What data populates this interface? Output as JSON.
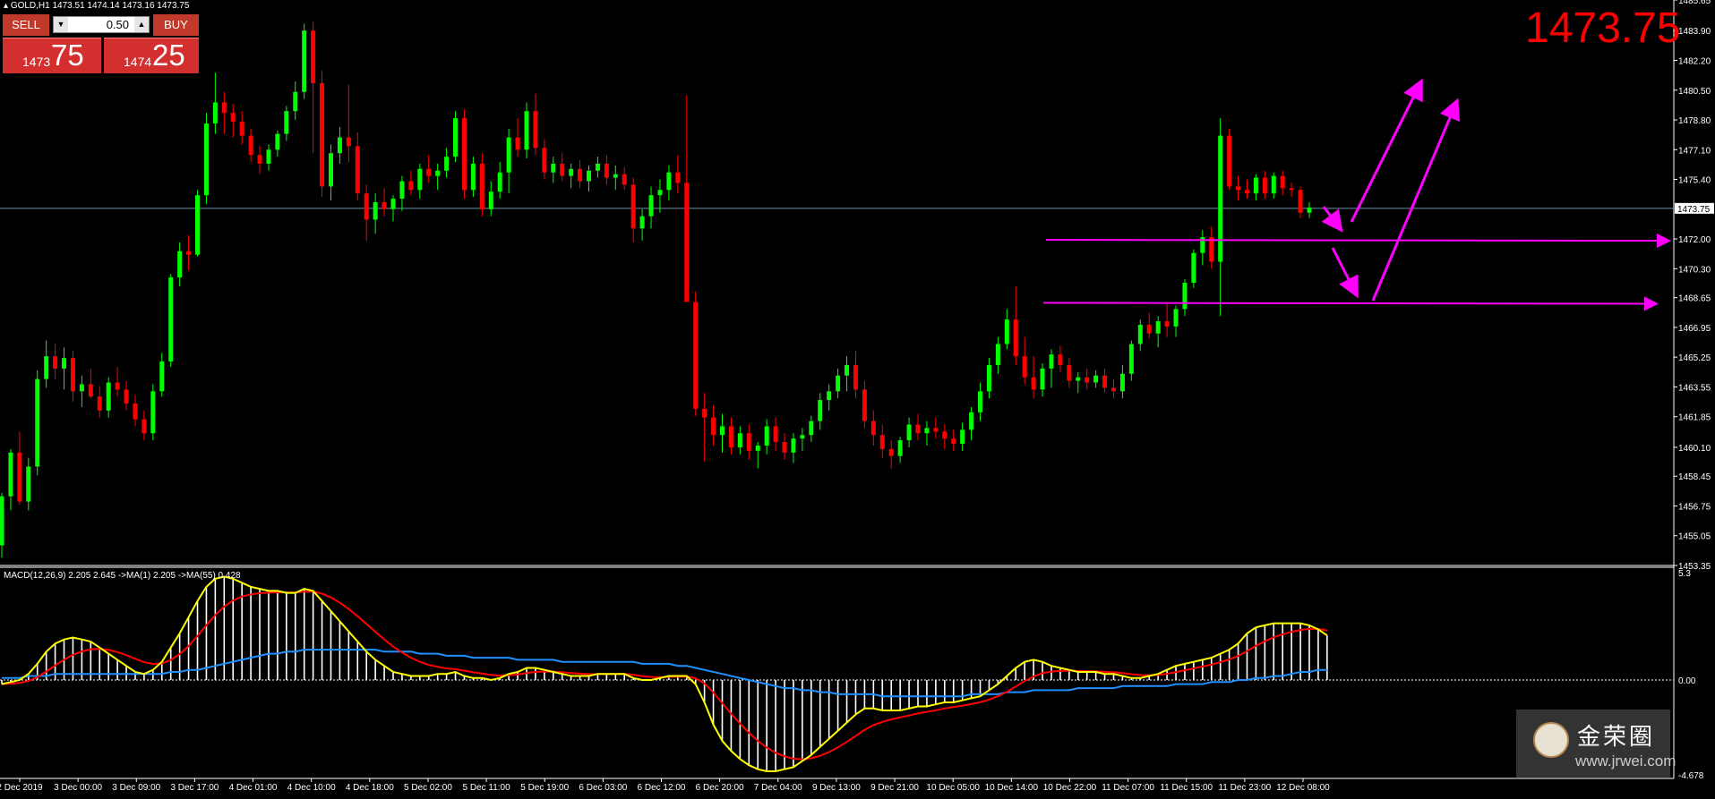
{
  "header": {
    "symbol": "GOLD,H1",
    "ohlc": "1473.51 1474.14 1473.16 1473.75"
  },
  "trade_panel": {
    "sell_label": "SELL",
    "buy_label": "BUY",
    "lot": "0.50",
    "sell_small": "1473",
    "sell_big": "75",
    "buy_small": "1474",
    "buy_big": "25"
  },
  "big_price": "1473.75",
  "macd_label": "MACD(12,26,9) 2.205 2.645 ->MA(1) 2.205 ->MA(55) 0.428",
  "watermark": {
    "title": "金荣圈",
    "url": "www.jrwei.com"
  },
  "colors": {
    "bull": "#00ff00",
    "bear": "#ff0000",
    "arrow": "#ff00ff",
    "grid": "#ffffff",
    "price_line": "#6f8fa8",
    "macd": "#ffff00",
    "signal": "#ff0000",
    "ma55": "#1e90ff",
    "histogram": "#ffffff"
  },
  "chart_data": {
    "type": "candlestick",
    "title": "",
    "ylim": [
      1453.35,
      1485.65
    ],
    "y_ticks": [
      "1485.65",
      "1483.90",
      "1482.20",
      "1480.50",
      "1478.80",
      "1477.10",
      "1475.40",
      "1472.00",
      "1470.30",
      "1468.65",
      "1466.95",
      "1465.25",
      "1463.55",
      "1461.85",
      "1460.10",
      "1458.45",
      "1456.75",
      "1455.05",
      "1453.35"
    ],
    "current_price": "1473.75",
    "x_ticks": [
      "2 Dec 2019",
      "3 Dec 00:00",
      "3 Dec 09:00",
      "3 Dec 17:00",
      "4 Dec 01:00",
      "4 Dec 10:00",
      "4 Dec 18:00",
      "5 Dec 02:00",
      "5 Dec 11:00",
      "5 Dec 19:00",
      "6 Dec 03:00",
      "6 Dec 12:00",
      "6 Dec 20:00",
      "7 Dec 04:00",
      "9 Dec 13:00",
      "9 Dec 21:00",
      "10 Dec 05:00",
      "10 Dec 14:00",
      "10 Dec 22:00",
      "11 Dec 07:00",
      "11 Dec 15:00",
      "11 Dec 23:00",
      "12 Dec 08:00"
    ],
    "candles": [
      [
        1454.5,
        1457.5,
        1453.8,
        1457.3
      ],
      [
        1457.3,
        1460.0,
        1456.5,
        1459.8
      ],
      [
        1459.8,
        1461.0,
        1456.8,
        1457.0
      ],
      [
        1457.0,
        1459.5,
        1456.5,
        1459.0
      ],
      [
        1459.0,
        1464.5,
        1458.5,
        1464.0
      ],
      [
        1464.0,
        1466.2,
        1463.5,
        1465.3
      ],
      [
        1465.3,
        1466.0,
        1464.0,
        1464.6
      ],
      [
        1464.6,
        1465.8,
        1463.4,
        1465.2
      ],
      [
        1465.2,
        1465.6,
        1462.7,
        1463.3
      ],
      [
        1463.3,
        1464.2,
        1462.4,
        1463.7
      ],
      [
        1463.7,
        1464.6,
        1462.9,
        1463.0
      ],
      [
        1463.0,
        1463.6,
        1461.8,
        1462.2
      ],
      [
        1462.2,
        1464.1,
        1461.8,
        1463.8
      ],
      [
        1463.8,
        1464.7,
        1463.0,
        1463.4
      ],
      [
        1463.4,
        1463.9,
        1462.2,
        1462.6
      ],
      [
        1462.6,
        1463.1,
        1461.3,
        1461.7
      ],
      [
        1461.7,
        1462.2,
        1460.5,
        1460.9
      ],
      [
        1460.9,
        1463.7,
        1460.5,
        1463.3
      ],
      [
        1463.3,
        1465.5,
        1463.0,
        1465.0
      ],
      [
        1465.0,
        1470.0,
        1464.7,
        1469.8
      ],
      [
        1469.8,
        1471.8,
        1469.3,
        1471.3
      ],
      [
        1471.3,
        1472.2,
        1470.2,
        1471.1
      ],
      [
        1471.1,
        1474.8,
        1471.0,
        1474.5
      ],
      [
        1474.5,
        1479.2,
        1474.0,
        1478.6
      ],
      [
        1478.6,
        1481.5,
        1478.0,
        1479.8
      ],
      [
        1479.8,
        1480.4,
        1478.0,
        1479.2
      ],
      [
        1479.2,
        1479.7,
        1477.8,
        1478.7
      ],
      [
        1478.7,
        1479.3,
        1477.4,
        1477.9
      ],
      [
        1477.9,
        1478.3,
        1476.4,
        1476.8
      ],
      [
        1476.8,
        1477.3,
        1475.7,
        1476.3
      ],
      [
        1476.3,
        1477.4,
        1475.9,
        1477.1
      ],
      [
        1477.1,
        1478.2,
        1476.7,
        1478.0
      ],
      [
        1478.0,
        1479.6,
        1477.6,
        1479.3
      ],
      [
        1479.3,
        1481.0,
        1478.8,
        1480.4
      ],
      [
        1480.4,
        1484.3,
        1480.0,
        1483.9
      ],
      [
        1483.9,
        1484.4,
        1476.9,
        1480.9
      ],
      [
        1480.9,
        1481.6,
        1474.4,
        1475.0
      ],
      [
        1475.0,
        1477.4,
        1474.2,
        1476.9
      ],
      [
        1476.9,
        1478.4,
        1476.3,
        1477.8
      ],
      [
        1477.8,
        1480.8,
        1476.4,
        1477.3
      ],
      [
        1477.3,
        1478.1,
        1474.2,
        1474.6
      ],
      [
        1474.6,
        1475.1,
        1471.9,
        1473.1
      ],
      [
        1473.1,
        1474.6,
        1472.3,
        1474.1
      ],
      [
        1474.1,
        1474.9,
        1473.3,
        1473.7
      ],
      [
        1473.7,
        1474.5,
        1473.0,
        1474.3
      ],
      [
        1474.3,
        1475.6,
        1473.6,
        1475.3
      ],
      [
        1475.3,
        1475.9,
        1474.5,
        1474.8
      ],
      [
        1474.8,
        1476.3,
        1474.3,
        1476.0
      ],
      [
        1476.0,
        1476.8,
        1475.2,
        1475.6
      ],
      [
        1475.6,
        1476.3,
        1474.8,
        1475.9
      ],
      [
        1475.9,
        1477.2,
        1475.5,
        1476.7
      ],
      [
        1476.7,
        1479.3,
        1476.4,
        1478.9
      ],
      [
        1478.9,
        1479.4,
        1474.3,
        1474.8
      ],
      [
        1474.8,
        1476.7,
        1474.4,
        1476.3
      ],
      [
        1476.3,
        1476.9,
        1473.3,
        1473.7
      ],
      [
        1473.7,
        1475.3,
        1473.3,
        1474.7
      ],
      [
        1474.7,
        1476.4,
        1474.3,
        1475.8
      ],
      [
        1475.8,
        1478.3,
        1474.6,
        1477.8
      ],
      [
        1477.8,
        1478.9,
        1476.7,
        1477.1
      ],
      [
        1477.1,
        1479.8,
        1476.6,
        1479.3
      ],
      [
        1479.3,
        1480.3,
        1476.8,
        1477.2
      ],
      [
        1477.2,
        1477.7,
        1475.4,
        1475.8
      ],
      [
        1475.8,
        1476.7,
        1475.2,
        1476.3
      ],
      [
        1476.3,
        1476.9,
        1475.3,
        1475.6
      ],
      [
        1475.6,
        1476.3,
        1474.9,
        1476.0
      ],
      [
        1476.0,
        1476.5,
        1474.9,
        1475.3
      ],
      [
        1475.3,
        1476.2,
        1474.7,
        1475.9
      ],
      [
        1475.9,
        1476.7,
        1475.5,
        1476.3
      ],
      [
        1476.3,
        1476.8,
        1475.1,
        1475.5
      ],
      [
        1475.5,
        1476.2,
        1474.8,
        1475.7
      ],
      [
        1475.7,
        1476.1,
        1474.8,
        1475.1
      ],
      [
        1475.1,
        1475.5,
        1471.8,
        1472.6
      ],
      [
        1472.6,
        1473.7,
        1471.9,
        1473.3
      ],
      [
        1473.3,
        1475.0,
        1472.6,
        1474.5
      ],
      [
        1474.5,
        1475.4,
        1473.5,
        1474.8
      ],
      [
        1474.8,
        1476.2,
        1474.2,
        1475.8
      ],
      [
        1475.8,
        1476.8,
        1474.6,
        1475.2
      ],
      [
        1475.2,
        1480.2,
        1474.2,
        1468.4
      ],
      [
        1468.4,
        1469.0,
        1461.9,
        1462.3
      ],
      [
        1462.3,
        1463.2,
        1459.3,
        1461.8
      ],
      [
        1461.8,
        1462.5,
        1460.2,
        1460.8
      ],
      [
        1460.8,
        1462.0,
        1459.8,
        1461.3
      ],
      [
        1461.3,
        1461.8,
        1459.7,
        1460.1
      ],
      [
        1460.1,
        1461.3,
        1459.7,
        1460.9
      ],
      [
        1460.9,
        1461.4,
        1459.4,
        1459.9
      ],
      [
        1459.9,
        1460.4,
        1458.9,
        1460.2
      ],
      [
        1460.2,
        1461.7,
        1459.7,
        1461.3
      ],
      [
        1461.3,
        1461.8,
        1459.9,
        1460.4
      ],
      [
        1460.4,
        1460.9,
        1459.4,
        1459.8
      ],
      [
        1459.8,
        1460.9,
        1459.2,
        1460.6
      ],
      [
        1460.6,
        1461.2,
        1459.9,
        1460.8
      ],
      [
        1460.8,
        1461.9,
        1460.4,
        1461.6
      ],
      [
        1461.6,
        1463.2,
        1461.1,
        1462.8
      ],
      [
        1462.8,
        1463.7,
        1462.2,
        1463.3
      ],
      [
        1463.3,
        1464.6,
        1462.9,
        1464.2
      ],
      [
        1464.2,
        1465.3,
        1463.3,
        1464.8
      ],
      [
        1464.8,
        1465.6,
        1462.9,
        1463.4
      ],
      [
        1463.4,
        1463.9,
        1461.2,
        1461.6
      ],
      [
        1461.6,
        1462.2,
        1460.2,
        1460.8
      ],
      [
        1460.8,
        1461.4,
        1459.5,
        1460.0
      ],
      [
        1460.0,
        1460.5,
        1458.9,
        1459.6
      ],
      [
        1459.6,
        1460.7,
        1459.2,
        1460.5
      ],
      [
        1460.5,
        1461.8,
        1460.1,
        1461.4
      ],
      [
        1461.4,
        1462.0,
        1460.5,
        1460.9
      ],
      [
        1460.9,
        1461.6,
        1460.2,
        1461.2
      ],
      [
        1461.2,
        1461.8,
        1460.6,
        1461.0
      ],
      [
        1461.0,
        1461.4,
        1460.0,
        1460.6
      ],
      [
        1460.6,
        1461.1,
        1459.9,
        1460.3
      ],
      [
        1460.3,
        1461.5,
        1459.9,
        1461.1
      ],
      [
        1461.1,
        1462.4,
        1460.5,
        1462.1
      ],
      [
        1462.1,
        1463.8,
        1461.6,
        1463.3
      ],
      [
        1463.3,
        1465.2,
        1462.9,
        1464.8
      ],
      [
        1464.8,
        1466.4,
        1464.3,
        1466.0
      ],
      [
        1466.0,
        1468.0,
        1465.7,
        1467.4
      ],
      [
        1467.4,
        1469.3,
        1464.8,
        1465.3
      ],
      [
        1465.3,
        1466.4,
        1463.7,
        1464.1
      ],
      [
        1464.1,
        1465.3,
        1462.9,
        1463.4
      ],
      [
        1463.4,
        1464.9,
        1463.0,
        1464.6
      ],
      [
        1464.6,
        1465.7,
        1463.5,
        1465.4
      ],
      [
        1465.4,
        1465.9,
        1464.4,
        1464.8
      ],
      [
        1464.8,
        1465.2,
        1463.5,
        1463.9
      ],
      [
        1463.9,
        1464.4,
        1463.2,
        1464.1
      ],
      [
        1464.1,
        1464.6,
        1463.4,
        1463.8
      ],
      [
        1463.8,
        1464.5,
        1463.5,
        1464.2
      ],
      [
        1464.2,
        1464.6,
        1463.2,
        1463.5
      ],
      [
        1463.5,
        1464.0,
        1462.9,
        1463.3
      ],
      [
        1463.3,
        1464.8,
        1462.9,
        1464.3
      ],
      [
        1464.3,
        1466.2,
        1463.9,
        1466.0
      ],
      [
        1466.0,
        1467.4,
        1465.6,
        1467.1
      ],
      [
        1467.1,
        1467.8,
        1466.3,
        1466.6
      ],
      [
        1466.6,
        1467.6,
        1465.8,
        1467.3
      ],
      [
        1467.3,
        1468.4,
        1466.4,
        1467.0
      ],
      [
        1467.0,
        1468.2,
        1466.4,
        1468.0
      ],
      [
        1468.0,
        1469.7,
        1467.6,
        1469.5
      ],
      [
        1469.5,
        1471.4,
        1469.2,
        1471.2
      ],
      [
        1471.2,
        1472.5,
        1470.5,
        1472.1
      ],
      [
        1472.1,
        1472.7,
        1470.3,
        1470.7
      ],
      [
        1470.7,
        1478.9,
        1467.6,
        1477.9
      ],
      [
        1477.9,
        1478.3,
        1474.8,
        1475.0
      ],
      [
        1475.0,
        1475.6,
        1474.2,
        1474.8
      ],
      [
        1474.8,
        1475.4,
        1474.3,
        1474.6
      ],
      [
        1474.6,
        1475.7,
        1474.2,
        1475.5
      ],
      [
        1475.5,
        1475.9,
        1474.3,
        1474.6
      ],
      [
        1474.6,
        1475.8,
        1474.3,
        1475.6
      ],
      [
        1475.6,
        1475.9,
        1474.5,
        1474.9
      ],
      [
        1474.9,
        1475.2,
        1474.4,
        1474.8
      ],
      [
        1474.8,
        1475.0,
        1473.2,
        1473.5
      ],
      [
        1473.5,
        1474.1,
        1473.2,
        1473.8
      ]
    ],
    "horizontal_levels": [
      1471.95,
      1468.35
    ],
    "macd": {
      "ylim": [
        -4.678,
        5.3
      ],
      "y_ticks": [
        "5.3",
        "0.00",
        "-4.678"
      ],
      "histogram": [
        -0.2,
        -0.1,
        0.0,
        0.3,
        0.8,
        1.4,
        1.8,
        2.0,
        2.1,
        2.0,
        1.9,
        1.6,
        1.3,
        1.0,
        0.7,
        0.4,
        0.3,
        0.5,
        0.9,
        1.6,
        2.3,
        3.1,
        3.9,
        4.6,
        5.0,
        5.1,
        5.0,
        4.8,
        4.6,
        4.5,
        4.4,
        4.4,
        4.3,
        4.3,
        4.5,
        4.4,
        3.9,
        3.4,
        2.9,
        2.4,
        1.9,
        1.4,
        1.0,
        0.7,
        0.4,
        0.3,
        0.2,
        0.2,
        0.2,
        0.3,
        0.3,
        0.4,
        0.2,
        0.1,
        0.1,
        0.0,
        0.1,
        0.3,
        0.4,
        0.6,
        0.6,
        0.5,
        0.4,
        0.3,
        0.2,
        0.2,
        0.2,
        0.3,
        0.3,
        0.3,
        0.3,
        0.1,
        0.0,
        0.0,
        0.1,
        0.2,
        0.2,
        0.2,
        -0.2,
        -1.1,
        -2.2,
        -3.0,
        -3.5,
        -3.9,
        -4.2,
        -4.4,
        -4.5,
        -4.5,
        -4.4,
        -4.3,
        -4.0,
        -3.7,
        -3.3,
        -2.9,
        -2.5,
        -2.1,
        -1.7,
        -1.4,
        -1.4,
        -1.5,
        -1.5,
        -1.5,
        -1.4,
        -1.3,
        -1.3,
        -1.2,
        -1.1,
        -1.1,
        -1.0,
        -0.9,
        -0.8,
        -0.5,
        -0.2,
        0.2,
        0.6,
        0.9,
        1.0,
        0.9,
        0.7,
        0.6,
        0.5,
        0.4,
        0.4,
        0.4,
        0.3,
        0.3,
        0.2,
        0.1,
        0.1,
        0.2,
        0.3,
        0.5,
        0.7,
        0.8,
        0.9,
        1.0,
        1.1,
        1.3,
        1.5,
        1.8,
        2.3,
        2.6,
        2.7,
        2.8,
        2.8,
        2.8,
        2.8,
        2.7,
        2.5,
        2.2
      ],
      "ma55": [
        0.1,
        0.1,
        0.1,
        0.2,
        0.2,
        0.2,
        0.3,
        0.3,
        0.3,
        0.3,
        0.3,
        0.3,
        0.3,
        0.3,
        0.3,
        0.3,
        0.3,
        0.3,
        0.3,
        0.4,
        0.4,
        0.5,
        0.5,
        0.6,
        0.7,
        0.8,
        0.9,
        1.0,
        1.1,
        1.2,
        1.3,
        1.3,
        1.4,
        1.4,
        1.5,
        1.5,
        1.5,
        1.5,
        1.5,
        1.5,
        1.5,
        1.5,
        1.5,
        1.4,
        1.4,
        1.4,
        1.4,
        1.3,
        1.3,
        1.3,
        1.2,
        1.2,
        1.2,
        1.1,
        1.1,
        1.1,
        1.1,
        1.1,
        1.0,
        1.0,
        1.0,
        1.0,
        1.0,
        0.9,
        0.9,
        0.9,
        0.9,
        0.9,
        0.9,
        0.9,
        0.9,
        0.9,
        0.8,
        0.8,
        0.8,
        0.8,
        0.7,
        0.7,
        0.6,
        0.5,
        0.4,
        0.3,
        0.2,
        0.1,
        0.0,
        -0.1,
        -0.2,
        -0.3,
        -0.4,
        -0.4,
        -0.5,
        -0.5,
        -0.6,
        -0.6,
        -0.7,
        -0.7,
        -0.7,
        -0.7,
        -0.7,
        -0.8,
        -0.8,
        -0.8,
        -0.8,
        -0.8,
        -0.8,
        -0.8,
        -0.8,
        -0.8,
        -0.8,
        -0.7,
        -0.7,
        -0.7,
        -0.7,
        -0.6,
        -0.6,
        -0.6,
        -0.5,
        -0.5,
        -0.5,
        -0.5,
        -0.5,
        -0.4,
        -0.4,
        -0.4,
        -0.4,
        -0.4,
        -0.3,
        -0.3,
        -0.3,
        -0.3,
        -0.3,
        -0.3,
        -0.2,
        -0.2,
        -0.2,
        -0.2,
        -0.1,
        -0.1,
        -0.1,
        0.0,
        0.0,
        0.1,
        0.1,
        0.2,
        0.2,
        0.3,
        0.4,
        0.4,
        0.5,
        0.5
      ]
    }
  }
}
